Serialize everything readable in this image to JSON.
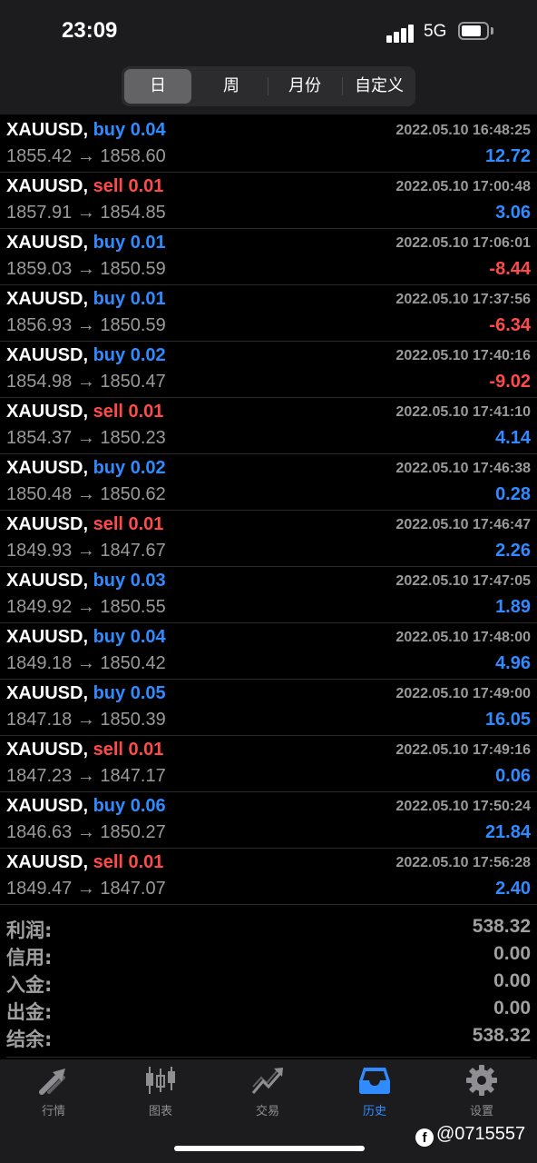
{
  "status_bar": {
    "time": "23:09",
    "network": "5G"
  },
  "period_tabs": [
    {
      "label": "日",
      "active": true
    },
    {
      "label": "周",
      "active": false
    },
    {
      "label": "月份",
      "active": false
    },
    {
      "label": "自定义",
      "active": false
    }
  ],
  "deals": [
    {
      "symbol": "XAUUSD,",
      "side": "buy",
      "side_label": "buy 0.04",
      "time": "2022.05.10 16:48:25",
      "prices": "1855.42 → 1858.60",
      "profit": "12.72"
    },
    {
      "symbol": "XAUUSD,",
      "side": "sell",
      "side_label": "sell 0.01",
      "time": "2022.05.10 17:00:48",
      "prices": "1857.91 → 1854.85",
      "profit": "3.06"
    },
    {
      "symbol": "XAUUSD,",
      "side": "buy",
      "side_label": "buy 0.01",
      "time": "2022.05.10 17:06:01",
      "prices": "1859.03 → 1850.59",
      "profit": "-8.44"
    },
    {
      "symbol": "XAUUSD,",
      "side": "buy",
      "side_label": "buy 0.01",
      "time": "2022.05.10 17:37:56",
      "prices": "1856.93 → 1850.59",
      "profit": "-6.34"
    },
    {
      "symbol": "XAUUSD,",
      "side": "buy",
      "side_label": "buy 0.02",
      "time": "2022.05.10 17:40:16",
      "prices": "1854.98 → 1850.47",
      "profit": "-9.02"
    },
    {
      "symbol": "XAUUSD,",
      "side": "sell",
      "side_label": "sell 0.01",
      "time": "2022.05.10 17:41:10",
      "prices": "1854.37 → 1850.23",
      "profit": "4.14"
    },
    {
      "symbol": "XAUUSD,",
      "side": "buy",
      "side_label": "buy 0.02",
      "time": "2022.05.10 17:46:38",
      "prices": "1850.48 → 1850.62",
      "profit": "0.28"
    },
    {
      "symbol": "XAUUSD,",
      "side": "sell",
      "side_label": "sell 0.01",
      "time": "2022.05.10 17:46:47",
      "prices": "1849.93 → 1847.67",
      "profit": "2.26"
    },
    {
      "symbol": "XAUUSD,",
      "side": "buy",
      "side_label": "buy 0.03",
      "time": "2022.05.10 17:47:05",
      "prices": "1849.92 → 1850.55",
      "profit": "1.89"
    },
    {
      "symbol": "XAUUSD,",
      "side": "buy",
      "side_label": "buy 0.04",
      "time": "2022.05.10 17:48:00",
      "prices": "1849.18 → 1850.42",
      "profit": "4.96"
    },
    {
      "symbol": "XAUUSD,",
      "side": "buy",
      "side_label": "buy 0.05",
      "time": "2022.05.10 17:49:00",
      "prices": "1847.18 → 1850.39",
      "profit": "16.05"
    },
    {
      "symbol": "XAUUSD,",
      "side": "sell",
      "side_label": "sell 0.01",
      "time": "2022.05.10 17:49:16",
      "prices": "1847.23 → 1847.17",
      "profit": "0.06"
    },
    {
      "symbol": "XAUUSD,",
      "side": "buy",
      "side_label": "buy 0.06",
      "time": "2022.05.10 17:50:24",
      "prices": "1846.63 → 1850.27",
      "profit": "21.84"
    },
    {
      "symbol": "XAUUSD,",
      "side": "sell",
      "side_label": "sell 0.01",
      "time": "2022.05.10 17:56:28",
      "prices": "1849.47 → 1847.07",
      "profit": "2.40"
    }
  ],
  "summary": [
    {
      "label": "利润:",
      "value": "538.32"
    },
    {
      "label": "信用:",
      "value": "0.00"
    },
    {
      "label": "入金:",
      "value": "0.00"
    },
    {
      "label": "出金:",
      "value": "0.00"
    },
    {
      "label": "结余:",
      "value": "538.32"
    }
  ],
  "tab_bar": [
    {
      "label": "行情",
      "icon": "quotes-arrows-icon",
      "active": false
    },
    {
      "label": "图表",
      "icon": "candlestick-chart-icon",
      "active": false
    },
    {
      "label": "交易",
      "icon": "trade-trend-icon",
      "active": false
    },
    {
      "label": "历史",
      "icon": "history-inbox-icon",
      "active": true
    },
    {
      "label": "设置",
      "icon": "gear-icon",
      "active": false
    }
  ],
  "watermark": {
    "text": "@0715557",
    "icon": "facebook-icon"
  },
  "colors": {
    "buy": "#2f8bff",
    "sell": "#ff4a4a",
    "active_tab": "#2f8bff"
  }
}
